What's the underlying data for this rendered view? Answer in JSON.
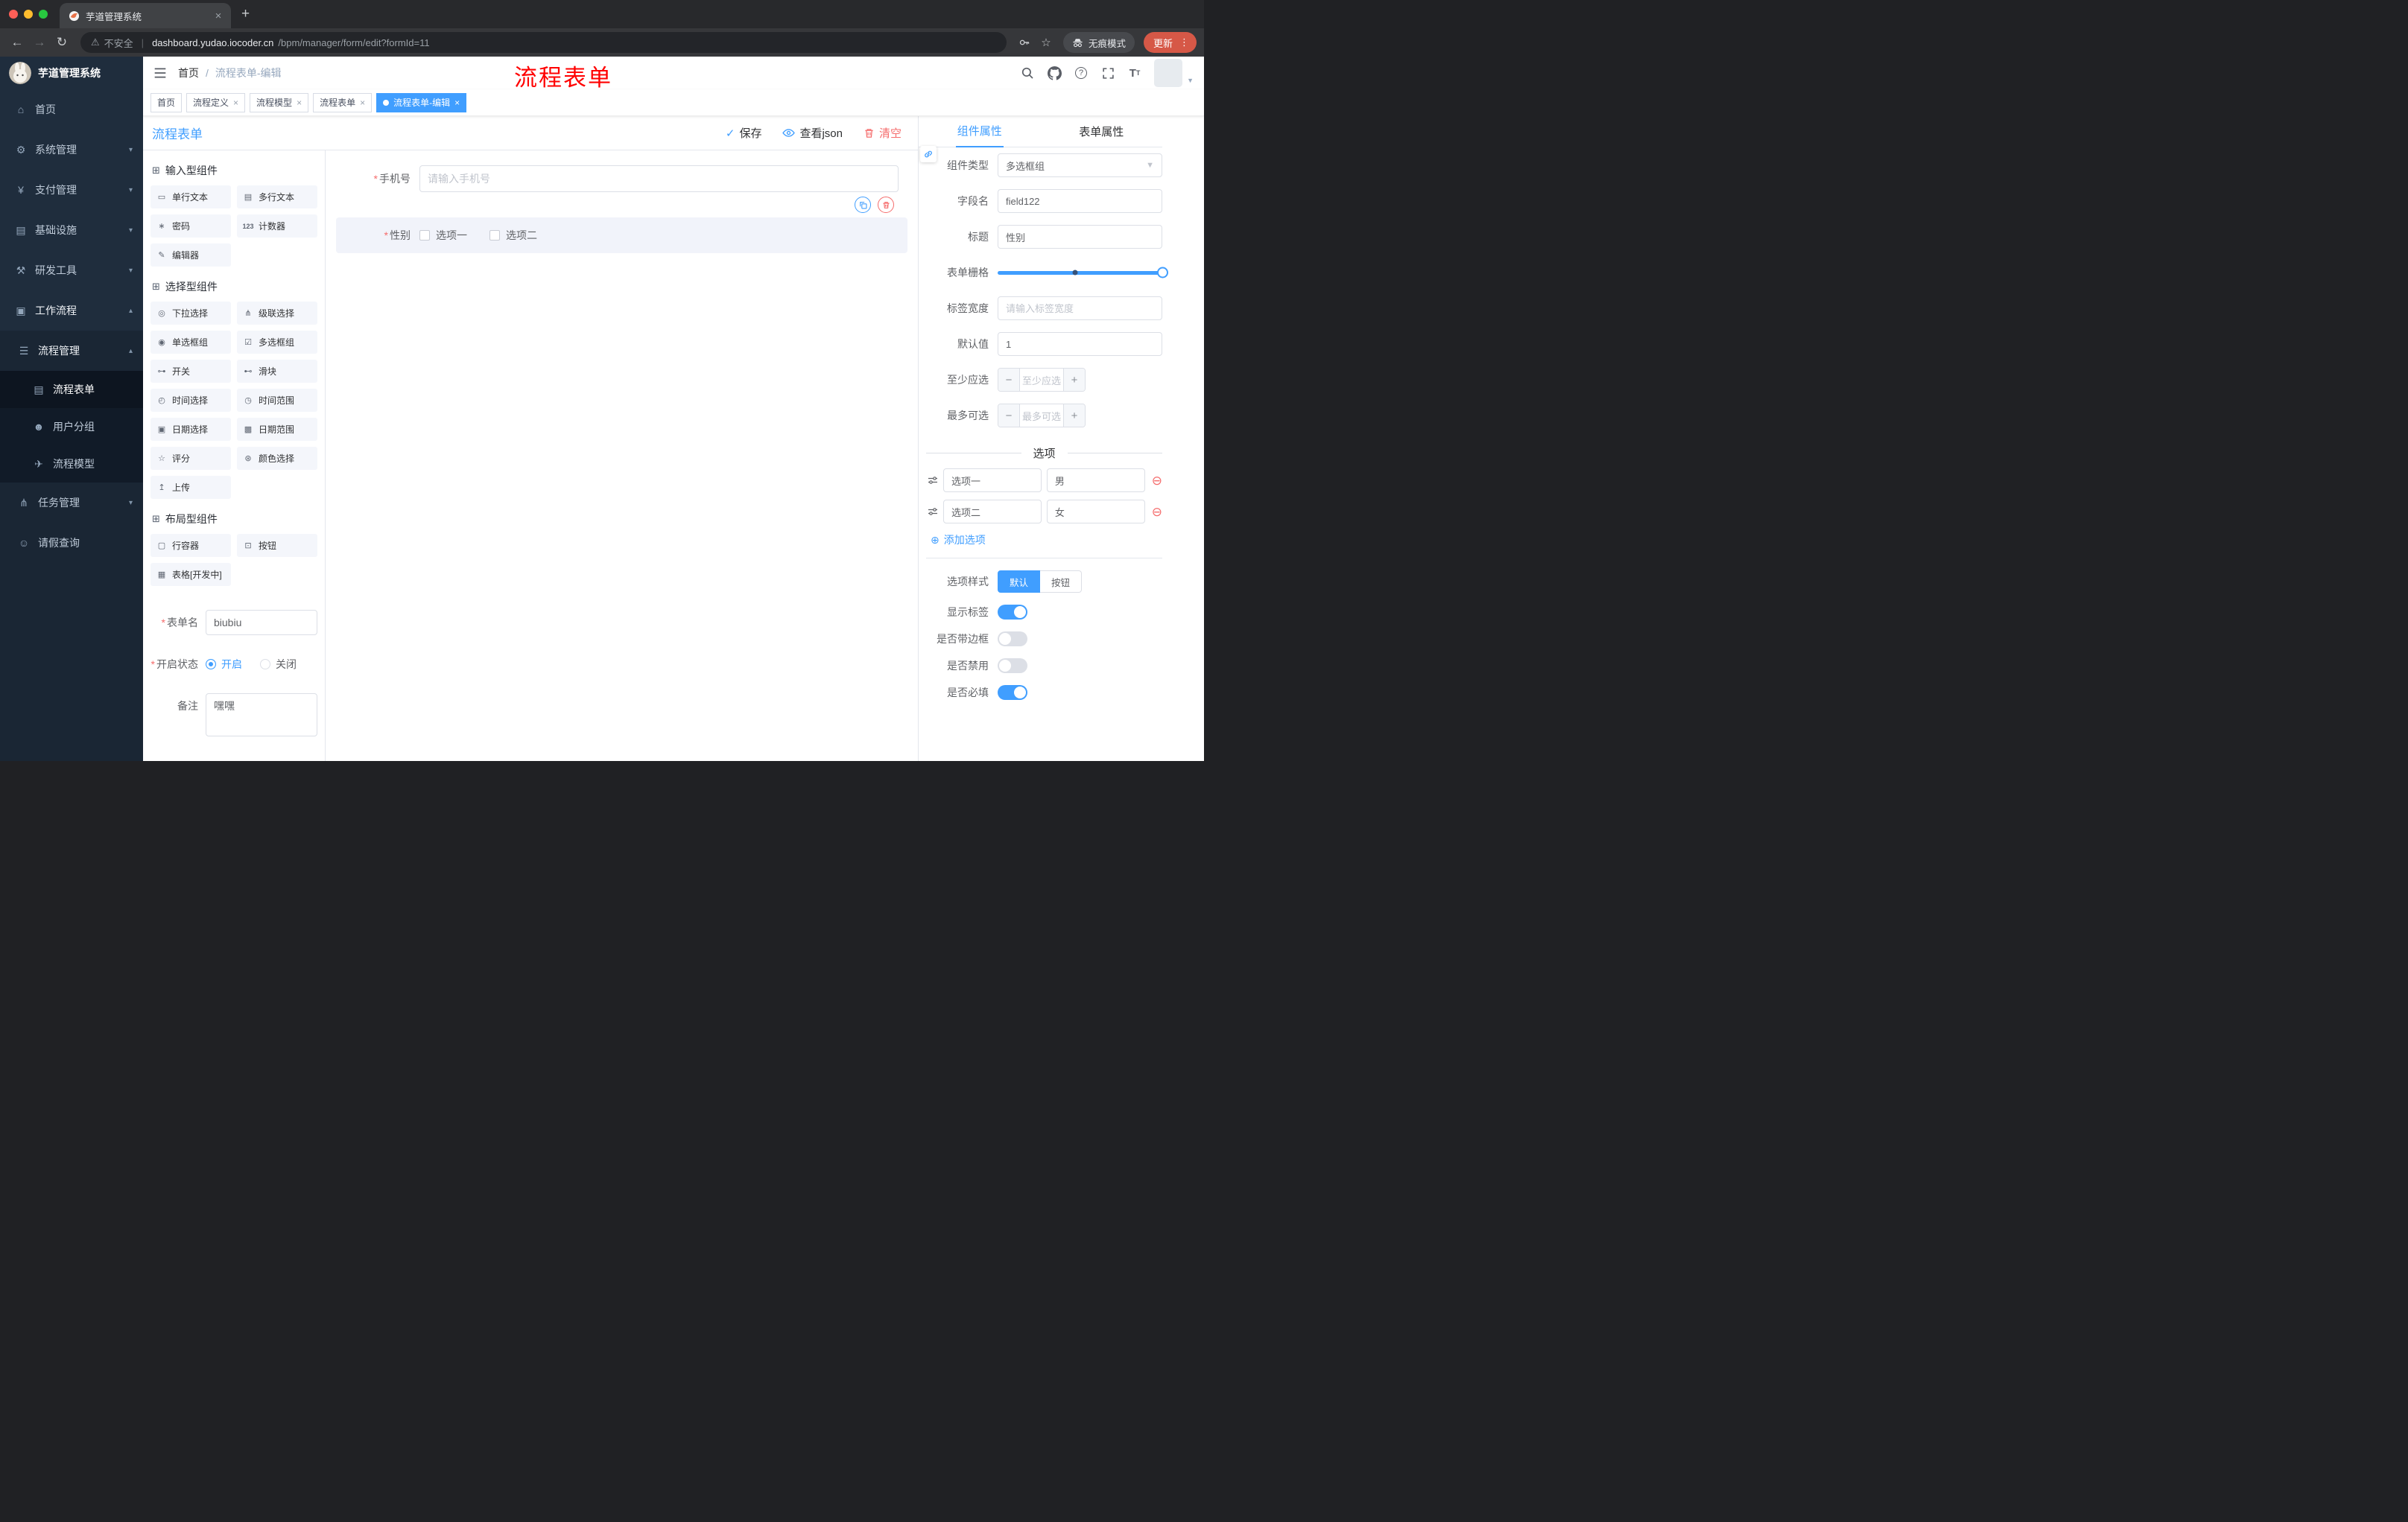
{
  "browser": {
    "tab_title": "芋道管理系统",
    "security_label": "不安全",
    "url_domain": "dashboard.yudao.iocoder.cn",
    "url_path": "/bpm/manager/form/edit?formId=11",
    "incognito_label": "无痕模式",
    "update_label": "更新"
  },
  "sidebar": {
    "brand": "芋道管理系统",
    "items": [
      {
        "label": "首页",
        "icon": "home-icon",
        "glyph": "⌂"
      },
      {
        "label": "系统管理",
        "icon": "gear-icon",
        "glyph": "⚙"
      },
      {
        "label": "支付管理",
        "icon": "payment-icon",
        "glyph": "¥"
      },
      {
        "label": "基础设施",
        "icon": "infrastructure-icon",
        "glyph": "▤"
      },
      {
        "label": "研发工具",
        "icon": "devtools-icon",
        "glyph": "⚒"
      },
      {
        "label": "工作流程",
        "icon": "workflow-icon",
        "glyph": "▣"
      }
    ],
    "submenu": {
      "process_mgmt": {
        "label": "流程管理",
        "icon": "list-icon",
        "glyph": "☰"
      },
      "children": [
        {
          "label": "流程表单",
          "icon": "document-icon",
          "glyph": "▤"
        },
        {
          "label": "用户分组",
          "icon": "users-icon",
          "glyph": "☻"
        },
        {
          "label": "流程模型",
          "icon": "send-icon",
          "glyph": "✈"
        }
      ],
      "task_mgmt": {
        "label": "任务管理",
        "icon": "tree-icon",
        "glyph": "⋔"
      },
      "leave_query": {
        "label": "请假查询",
        "icon": "user-icon",
        "glyph": "☺"
      }
    }
  },
  "navbar": {
    "breadcrumb_home": "首页",
    "breadcrumb_current": "流程表单-编辑",
    "annotation": "流程表单"
  },
  "tags": [
    {
      "label": "首页"
    },
    {
      "label": "流程定义"
    },
    {
      "label": "流程模型"
    },
    {
      "label": "流程表单"
    },
    {
      "label": "流程表单-编辑"
    }
  ],
  "designer": {
    "title": "流程表单",
    "save_label": "保存",
    "view_json_label": "查看json",
    "clear_label": "清空"
  },
  "palette": {
    "groups": [
      {
        "title": "输入型组件",
        "items": [
          {
            "label": "单行文本",
            "icon": "single-line-text-icon",
            "glyph": "▭"
          },
          {
            "label": "多行文本",
            "icon": "multi-line-text-icon",
            "glyph": "▤"
          },
          {
            "label": "密码",
            "icon": "password-icon",
            "glyph": "∗"
          },
          {
            "label": "计数器",
            "icon": "counter-icon",
            "glyph": "123"
          },
          {
            "label": "编辑器",
            "icon": "editor-icon",
            "glyph": "✎"
          }
        ]
      },
      {
        "title": "选择型组件",
        "items": [
          {
            "label": "下拉选择",
            "icon": "dropdown-icon",
            "glyph": "◎"
          },
          {
            "label": "级联选择",
            "icon": "cascader-icon",
            "glyph": "⋔"
          },
          {
            "label": "单选框组",
            "icon": "radio-group-icon",
            "glyph": "◉"
          },
          {
            "label": "多选框组",
            "icon": "checkbox-group-icon",
            "glyph": "☑"
          },
          {
            "label": "开关",
            "icon": "switch-icon",
            "glyph": "⊶"
          },
          {
            "label": "滑块",
            "icon": "slider-icon",
            "glyph": "⊷"
          },
          {
            "label": "时间选择",
            "icon": "time-picker-icon",
            "glyph": "◴"
          },
          {
            "label": "时间范围",
            "icon": "time-range-icon",
            "glyph": "◷"
          },
          {
            "label": "日期选择",
            "icon": "date-picker-icon",
            "glyph": "▣"
          },
          {
            "label": "日期范围",
            "icon": "date-range-icon",
            "glyph": "▩"
          },
          {
            "label": "评分",
            "icon": "rate-icon",
            "glyph": "☆"
          },
          {
            "label": "颜色选择",
            "icon": "color-picker-icon",
            "glyph": "⊛"
          },
          {
            "label": "上传",
            "icon": "upload-icon",
            "glyph": "↥"
          }
        ]
      },
      {
        "title": "布局型组件",
        "items": [
          {
            "label": "行容器",
            "icon": "row-container-icon",
            "glyph": "▢"
          },
          {
            "label": "按钮",
            "icon": "button-icon",
            "glyph": "⊡"
          },
          {
            "label": "表格[开发中]",
            "icon": "table-icon",
            "glyph": "▦"
          }
        ]
      }
    ]
  },
  "form_meta": {
    "name_label": "表单名",
    "name_value": "biubiu",
    "status_label": "开启状态",
    "status_on": "开启",
    "status_off": "关闭",
    "remark_label": "备注",
    "remark_value": "嘿嘿"
  },
  "canvas": {
    "phone": {
      "label": "手机号",
      "placeholder": "请输入手机号"
    },
    "gender": {
      "label": "性别",
      "option1": "选项一",
      "option2": "选项二"
    }
  },
  "props": {
    "tab_component": "组件属性",
    "tab_form": "表单属性",
    "component_type_label": "组件类型",
    "component_type_value": "多选框组",
    "field_name_label": "字段名",
    "field_name_value": "field122",
    "title_label": "标题",
    "title_value": "性别",
    "grid_label": "表单栅格",
    "label_width_label": "标签宽度",
    "label_width_placeholder": "请输入标签宽度",
    "default_label": "默认值",
    "default_value": "1",
    "min_label": "至少应选",
    "min_placeholder": "至少应选",
    "max_label": "最多可选",
    "max_placeholder": "最多可选",
    "options_title": "选项",
    "options": [
      {
        "label": "选项一",
        "value": "男"
      },
      {
        "label": "选项二",
        "value": "女"
      }
    ],
    "add_option_label": "添加选项",
    "style_label": "选项样式",
    "style_default": "默认",
    "style_button": "按钮",
    "toggles": [
      {
        "label": "显示标签",
        "on": true
      },
      {
        "label": "是否带边框",
        "on": false
      },
      {
        "label": "是否禁用",
        "on": false
      },
      {
        "label": "是否必填",
        "on": true
      }
    ]
  },
  "colors": {
    "primary": "#409eff",
    "danger": "#f56c6c",
    "annotation": "#ff0000"
  }
}
